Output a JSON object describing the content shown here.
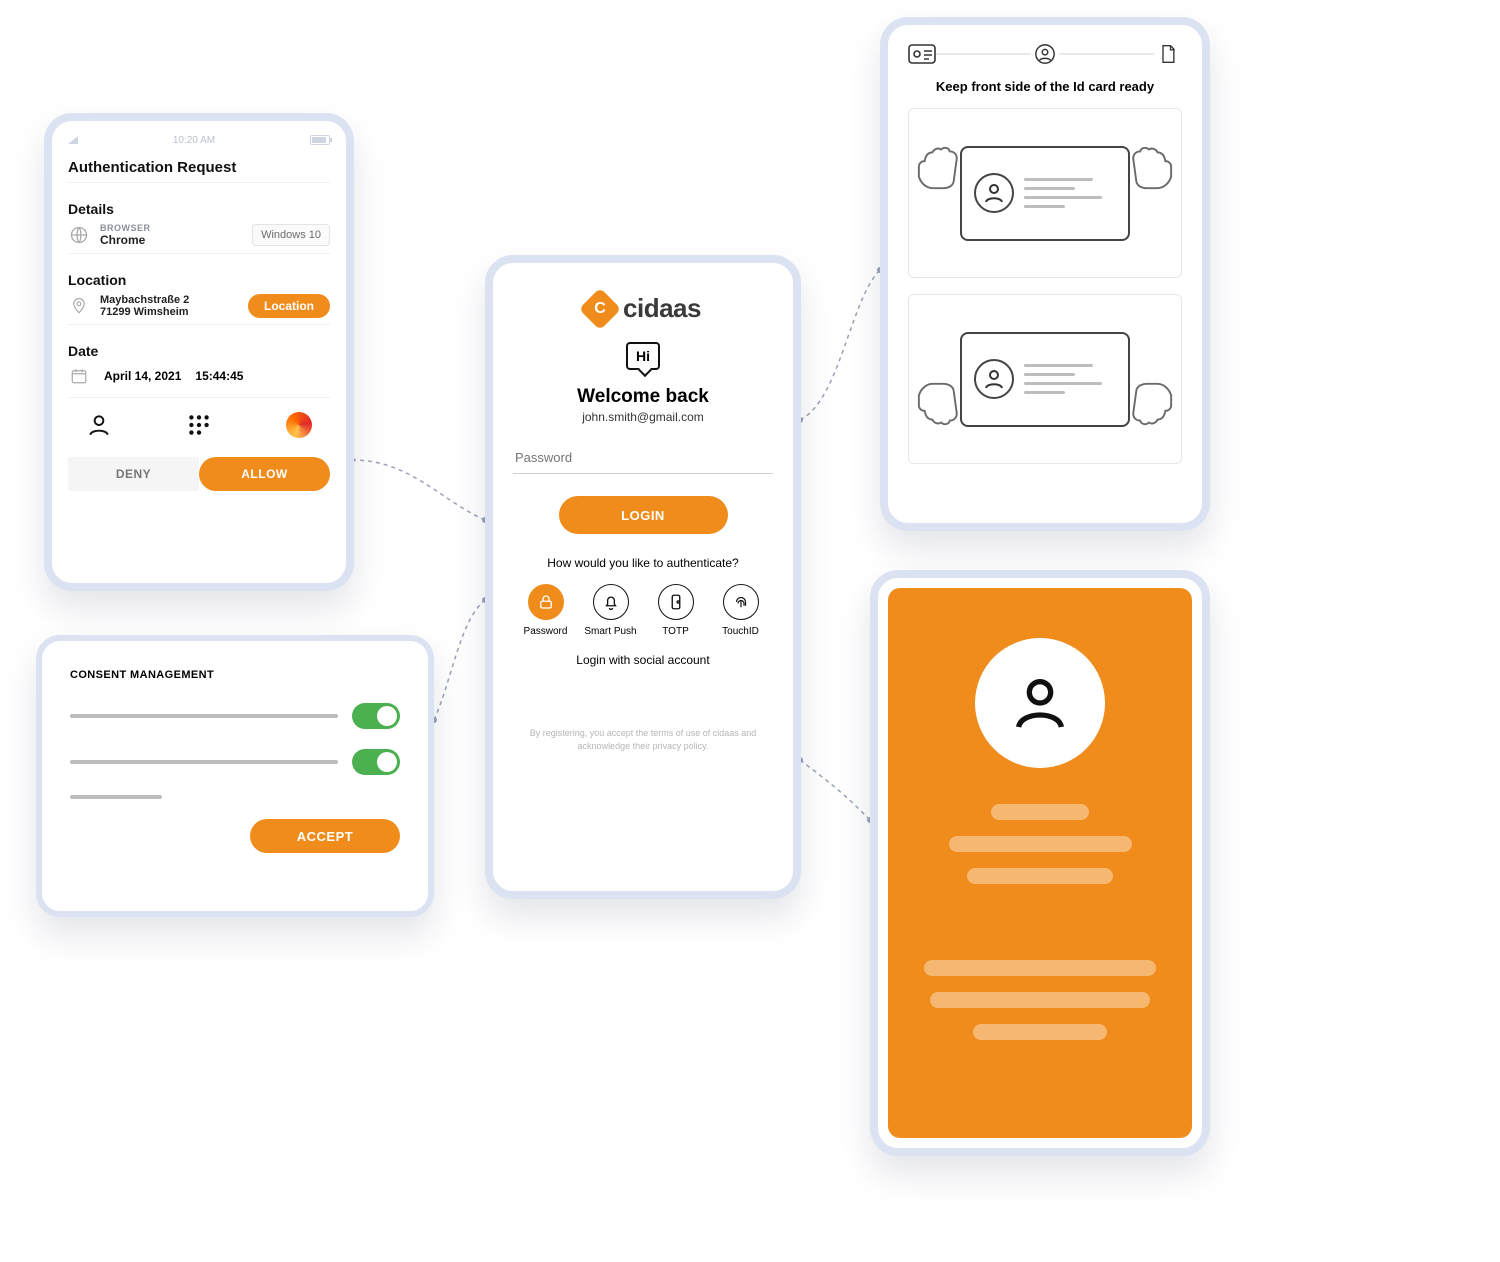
{
  "auth": {
    "time": "10:20 AM",
    "title": "Authentication Request",
    "details_heading": "Details",
    "browser_label": "BROWSER",
    "browser_value": "Chrome",
    "os_chip": "Windows 10",
    "location_heading": "Location",
    "address_line1": "Maybachstraße 2",
    "address_line2": "71299 Wimsheim",
    "location_pill": "Location",
    "date_heading": "Date",
    "date_value": "April 14, 2021",
    "time_value": "15:44:45",
    "deny_label": "DENY",
    "allow_label": "ALLOW"
  },
  "consent": {
    "title": "CONSENT MANAGEMENT",
    "accept_label": "ACCEPT"
  },
  "login": {
    "brand": "cidaas",
    "hi": "Hi",
    "welcome": "Welcome back",
    "email": "john.smith@gmail.com",
    "password_placeholder": "Password",
    "login_label": "LOGIN",
    "how_auth": "How would you like to authenticate?",
    "methods": {
      "password": "Password",
      "smartpush": "Smart Push",
      "totp": "TOTP",
      "touchid": "TouchID"
    },
    "social": "Login with social account",
    "terms": "By registering, you accept the terms of use of cidaas and acknowledge their privacy policy."
  },
  "idcard": {
    "title": "Keep front side of the Id card ready"
  }
}
